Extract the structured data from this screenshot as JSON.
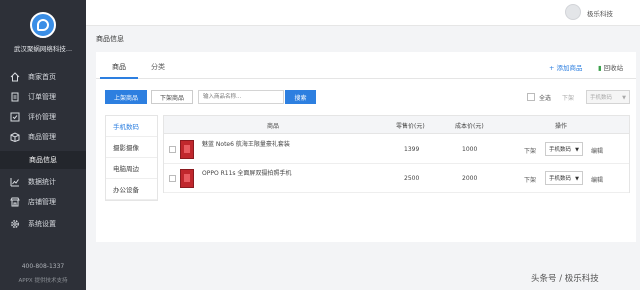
{
  "sidebar": {
    "company": "武汉聚蜗网络科技...",
    "items": [
      {
        "label": "商家首页",
        "icon": "home-icon"
      },
      {
        "label": "订单管理",
        "icon": "order-icon"
      },
      {
        "label": "评价管理",
        "icon": "review-icon"
      },
      {
        "label": "商品管理",
        "icon": "goods-icon"
      },
      {
        "label": "商品信息",
        "icon": ""
      },
      {
        "label": "数据统计",
        "icon": "chart-icon"
      },
      {
        "label": "店铺管理",
        "icon": "shop-icon"
      },
      {
        "label": "系统设置",
        "icon": "gear-icon"
      }
    ],
    "phone": "400-808-1337",
    "support": "APPX 提供技术支持"
  },
  "header": {
    "username": "极乐科技"
  },
  "breadcrumb": "商品信息",
  "tabs": [
    {
      "label": "商品"
    },
    {
      "label": "分类"
    }
  ],
  "actions": {
    "add": "添加商品",
    "recycle": "回收站"
  },
  "toolbar": {
    "on_shelf": "上架商品",
    "off_shelf": "下架商品",
    "search_placeholder": "输入商品名称...",
    "search": "搜索",
    "select_all": "全选",
    "bulk_off": "下架",
    "bulk_category": "手机数码"
  },
  "categories": [
    "手机数码",
    "摄影摄像",
    "电脑周边",
    "办公设备"
  ],
  "table": {
    "headers": {
      "product": "商品",
      "retail": "零售价(元)",
      "cost": "成本价(元)",
      "ops": "操作"
    },
    "rows": [
      {
        "name": "魅蓝 Note6 航海王限量豪礼套装",
        "retail": "1399",
        "cost": "1000",
        "off": "下架",
        "category": "手机数码",
        "edit": "编辑"
      },
      {
        "name": "OPPO R11s 全面屏双摄拍照手机",
        "retail": "2500",
        "cost": "2000",
        "off": "下架",
        "category": "手机数码",
        "edit": "编辑"
      }
    ]
  },
  "watermark": "头条号 / 极乐科技",
  "colors": {
    "accent": "#2d7fe0",
    "sidebar": "#2d3038"
  }
}
